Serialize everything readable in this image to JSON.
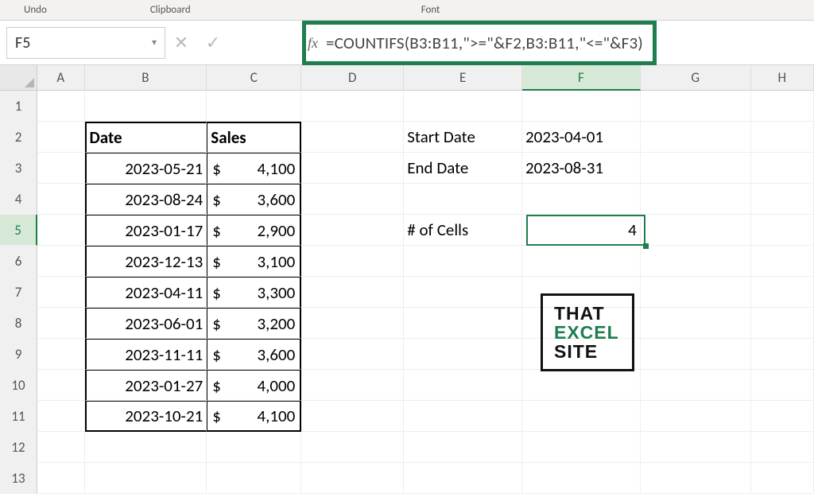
{
  "ribbon": {
    "undo": "Undo",
    "clipboard": "Clipboard",
    "font": "Font"
  },
  "nameBox": {
    "ref": "F5"
  },
  "formulaBar": {
    "text": "=COUNTIFS(B3:B11,\">=\"&F2,B3:B11,\"<=\"&F3)"
  },
  "columns": [
    "A",
    "B",
    "C",
    "D",
    "E",
    "F",
    "G",
    "H"
  ],
  "activeColumn": "F",
  "rowCount": 13,
  "activeRow": 5,
  "dataTable": {
    "headers": {
      "date": "Date",
      "sales": "Sales"
    },
    "rows": [
      {
        "date": "2023-05-21",
        "sales": "4,100"
      },
      {
        "date": "2023-08-24",
        "sales": "3,600"
      },
      {
        "date": "2023-01-17",
        "sales": "2,900"
      },
      {
        "date": "2023-12-13",
        "sales": "3,100"
      },
      {
        "date": "2023-04-11",
        "sales": "3,300"
      },
      {
        "date": "2023-06-01",
        "sales": "3,200"
      },
      {
        "date": "2023-11-11",
        "sales": "3,600"
      },
      {
        "date": "2023-01-27",
        "sales": "4,000"
      },
      {
        "date": "2023-10-21",
        "sales": "4,100"
      }
    ]
  },
  "summary": {
    "startLabel": "Start Date",
    "startValue": "2023-04-01",
    "endLabel": "End Date",
    "endValue": "2023-08-31",
    "countLabel": "# of Cells",
    "countValue": "4"
  },
  "currencySymbol": "$",
  "logo": {
    "l1": "THAT",
    "l2": "EXCEL",
    "l3": "SITE"
  }
}
